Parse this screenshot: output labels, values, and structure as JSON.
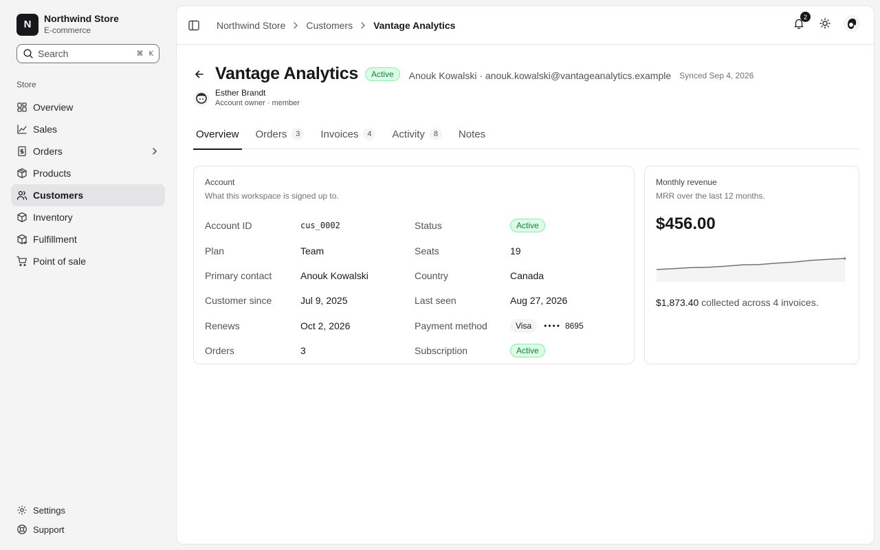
{
  "brand": {
    "logo_letter": "N",
    "name": "Northwind Store",
    "subtitle": "E-commerce"
  },
  "search": {
    "placeholder": "Search",
    "shortcut_mod": "⌘",
    "shortcut_key": "K"
  },
  "sidebar": {
    "group_label": "Store",
    "items": [
      {
        "label": "Overview",
        "icon": "layout-dashboard-icon"
      },
      {
        "label": "Sales",
        "icon": "chart-line-icon"
      },
      {
        "label": "Orders",
        "icon": "receipt-icon",
        "expandable": true
      },
      {
        "label": "Products",
        "icon": "package-icon"
      },
      {
        "label": "Customers",
        "icon": "users-icon",
        "active": true
      },
      {
        "label": "Inventory",
        "icon": "box-icon"
      },
      {
        "label": "Fulfillment",
        "icon": "truck-box-icon"
      },
      {
        "label": "Point of sale",
        "icon": "cart-icon"
      }
    ],
    "bottom": [
      {
        "label": "Settings",
        "icon": "gear-icon"
      },
      {
        "label": "Support",
        "icon": "lifebuoy-icon"
      }
    ]
  },
  "topbar": {
    "breadcrumbs": [
      "Northwind Store",
      "Customers",
      "Vantage Analytics"
    ],
    "notification_count": "2"
  },
  "customer": {
    "name": "Vantage Analytics",
    "status": "Active",
    "contact": "Anouk Kowalski · anouk.kowalski@vantageanalytics.example",
    "synced": "Synced Sep 4, 2026",
    "owner_name": "Esther Brandt",
    "owner_role": "Account owner · member"
  },
  "tabs": [
    {
      "label": "Overview",
      "active": true
    },
    {
      "label": "Orders",
      "count": "3"
    },
    {
      "label": "Invoices",
      "count": "4"
    },
    {
      "label": "Activity",
      "count": "8"
    },
    {
      "label": "Notes"
    }
  ],
  "account": {
    "title": "Account",
    "description": "What this workspace is signed up to.",
    "fields": {
      "account_id_label": "Account ID",
      "account_id": "cus_0002",
      "status_label": "Status",
      "status": "Active",
      "plan_label": "Plan",
      "plan": "Team",
      "seats_label": "Seats",
      "seats": "19",
      "primary_contact_label": "Primary contact",
      "primary_contact": "Anouk Kowalski",
      "country_label": "Country",
      "country": "Canada",
      "customer_since_label": "Customer since",
      "customer_since": "Jul 9, 2025",
      "last_seen_label": "Last seen",
      "last_seen": "Aug 27, 2026",
      "renews_label": "Renews",
      "renews": "Oct 2, 2026",
      "payment_method_label": "Payment method",
      "payment_brand": "Visa",
      "payment_dots": "••••",
      "payment_last4": "8695",
      "orders_label": "Orders",
      "orders": "3",
      "subscription_label": "Subscription",
      "subscription": "Active"
    }
  },
  "revenue": {
    "title": "Monthly revenue",
    "description": "MRR over the last 12 months.",
    "value": "$456.00",
    "collected_amount": "$1,873.40",
    "collected_text": " collected across 4 invoices.",
    "trend": [
      12,
      13,
      14,
      14.5,
      15.5,
      17,
      17.5,
      19,
      20,
      22,
      23,
      24
    ]
  },
  "colors": {
    "accent": "#18181b",
    "success_bg": "#dcfce7",
    "success_text": "#15803d",
    "sidebar_bg": "#f4f4f5"
  }
}
